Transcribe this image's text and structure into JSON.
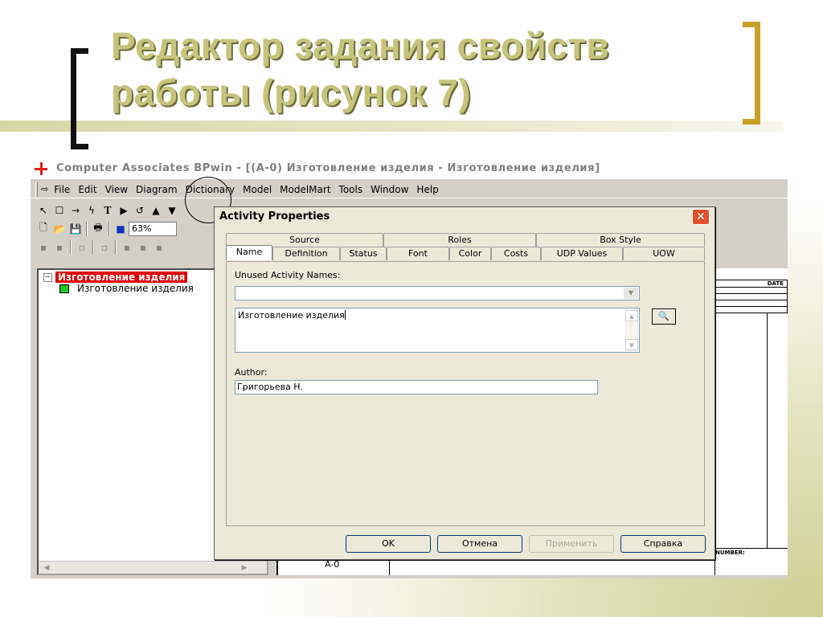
{
  "slide": {
    "title_line1": "Редактор задания свойств",
    "title_line2": "работы (рисунок 7)"
  },
  "app": {
    "title": "Computer Associates BPwin - [(A-0) Изготовление изделия - Изготовление изделия]",
    "menu": [
      "File",
      "Edit",
      "View",
      "Diagram",
      "Dictionary",
      "Model",
      "ModelMart",
      "Tools",
      "Window",
      "Help"
    ],
    "zoom": "63%"
  },
  "explorer": {
    "root_label": "Изготовление изделия",
    "child_label": "Изготовление изделия"
  },
  "diagram": {
    "date_header": "DATE",
    "number_label": "NUMBER:",
    "node_label": "A-0"
  },
  "dialog": {
    "title": "Activity Properties",
    "tabs_top": [
      "Source",
      "Roles",
      "Box Style"
    ],
    "tabs_bottom": [
      "Name",
      "Definition",
      "Status",
      "Font",
      "Color",
      "Costs",
      "UDP Values",
      "UOW"
    ],
    "unused_names_label": "Unused Activity Names:",
    "unused_names_value": "",
    "name_value": "Изготовление изделия",
    "author_label": "Author:",
    "author_value": "Григорьева Н.",
    "buttons": {
      "ok": "OK",
      "cancel": "Отмена",
      "apply": "Применить",
      "help": "Справка"
    }
  }
}
